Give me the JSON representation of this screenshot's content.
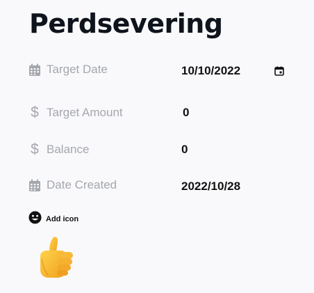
{
  "page": {
    "title": "Perdsevering"
  },
  "fields": {
    "target_date": {
      "label": "Target Date",
      "value": "10/10/2022",
      "icon": "calendar-icon"
    },
    "target_amount": {
      "label": "Target Amount",
      "value": "0",
      "icon": "dollar-icon"
    },
    "balance": {
      "label": "Balance",
      "value": "0",
      "icon": "dollar-icon"
    },
    "date_created": {
      "label": "Date Created",
      "value": "2022/10/28",
      "icon": "calendar-icon"
    }
  },
  "add_icon": {
    "label": "Add icon",
    "icon": "smiley-icon"
  },
  "selected_icon": {
    "name": "thumbs-up-icon"
  },
  "colors": {
    "background": "#f9f9fc",
    "label": "#a4a7ac",
    "value": "#111111",
    "thumb": "#f5b52c"
  }
}
